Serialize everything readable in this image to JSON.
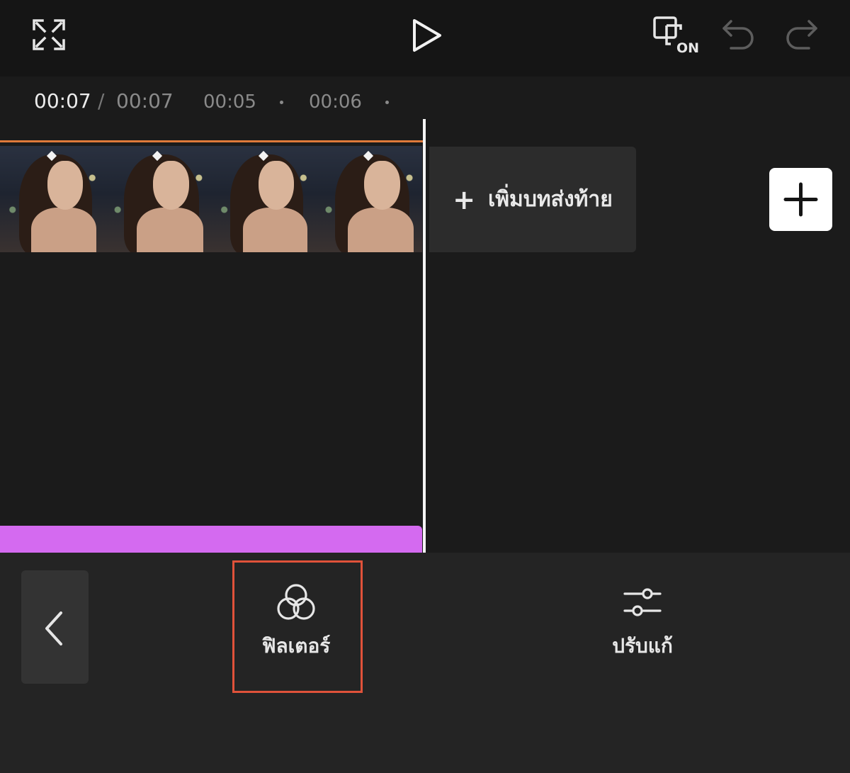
{
  "topbar": {
    "icons": [
      "fullscreen-icon",
      "play-icon",
      "preview-on-icon",
      "undo-icon",
      "redo-icon"
    ],
    "preview_badge": "ON"
  },
  "timeline": {
    "current_time": "00:07",
    "separator": "/",
    "total_time": "00:07",
    "ticks": [
      "00:05",
      "00:06"
    ],
    "add_ending_plus": "+",
    "add_ending_label": "เพิ่มบทส่งท้าย"
  },
  "toolbar": {
    "tools": [
      {
        "label": "ฟิลเตอร์",
        "icon": "filter-icon",
        "selected": true
      },
      {
        "label": "ปรับแก้",
        "icon": "adjust-sliders-icon",
        "selected": false
      }
    ]
  },
  "colors": {
    "accent_highlight": "#e0523a",
    "track_purple": "#d46af0",
    "clip_outline": "#e07a3a",
    "playhead": "#f5f5f5"
  }
}
